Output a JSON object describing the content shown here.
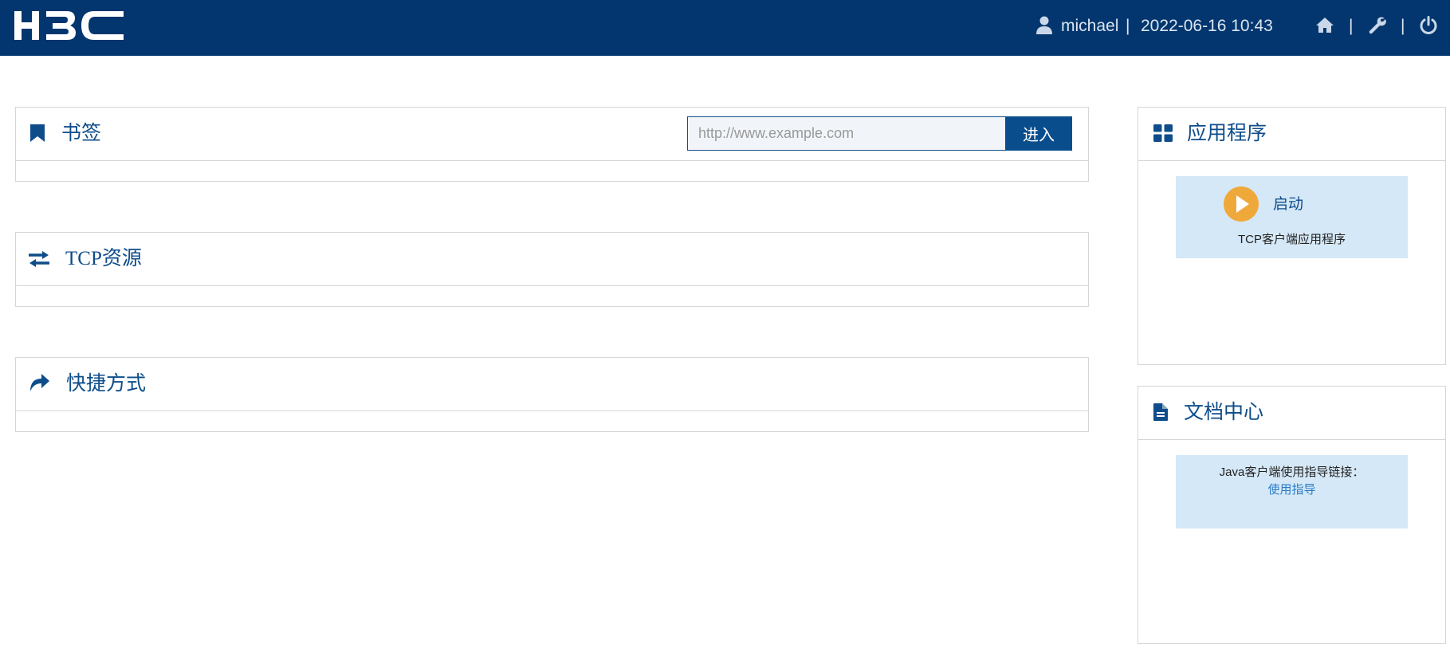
{
  "header": {
    "logo_text": "H3C",
    "username": "michael",
    "separator": "|",
    "datetime": "2022-06-16 10:43",
    "icons": [
      "user-icon",
      "home-icon",
      "wrench-icon",
      "power-icon"
    ]
  },
  "bookmarks": {
    "title": "书签",
    "icon": "bookmark-icon",
    "url_placeholder": "http://www.example.com",
    "url_value": "",
    "enter_label": "进入"
  },
  "tcp": {
    "title": "TCP资源",
    "icon": "exchange-arrows-icon"
  },
  "shortcuts": {
    "title": "快捷方式",
    "icon": "share-arrow-icon"
  },
  "apps": {
    "title": "应用程序",
    "icon": "grid-icon",
    "launch_label": "启动",
    "app_name": "TCP客户端应用程序"
  },
  "docs": {
    "title": "文档中心",
    "icon": "document-icon",
    "text": "Java客户端使用指导链接：",
    "link_label": "使用指导"
  },
  "colors": {
    "header_bg": "#03366e",
    "accent": "#0a4d8c",
    "card_bg": "#d5e8f7",
    "play_orange": "#efa83a",
    "link": "#2a7ac6"
  }
}
